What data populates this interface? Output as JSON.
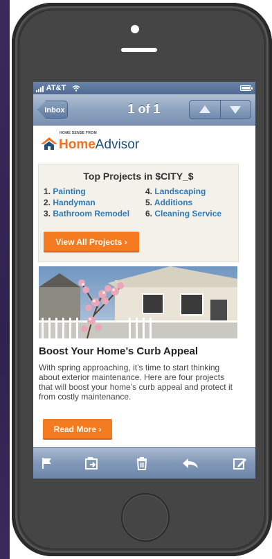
{
  "status_bar": {
    "carrier": "AT&T"
  },
  "nav": {
    "back_label": "Inbox",
    "title": "1 of 1",
    "up_icon": "arrow-up-icon",
    "down_icon": "arrow-down-icon"
  },
  "email": {
    "logo": {
      "tagline": "HOME SENSE FROM",
      "brand_home": "Home",
      "brand_advisor": "Advisor"
    },
    "projects": {
      "title": "Top Projects in $CITY_$",
      "left": [
        {
          "num": "1.",
          "label": "Painting"
        },
        {
          "num": "2.",
          "label": "Handyman"
        },
        {
          "num": "3.",
          "label": "Bathroom Remodel"
        }
      ],
      "right": [
        {
          "num": "4.",
          "label": "Landscaping"
        },
        {
          "num": "5.",
          "label": "Additions"
        },
        {
          "num": "6.",
          "label": "Cleaning Service"
        }
      ],
      "button": "View All Projects ›"
    },
    "article": {
      "title": "Boost Your Home’s Curb Appeal",
      "body": "With spring approaching, it’s time to start thinking about exterior maintenance. Here are four projects that will boost your home’s curb appeal and protect it from costly maintenance.",
      "button": "Read More ›"
    }
  },
  "toolbar": {
    "icons": [
      "flag-icon",
      "move-folder-icon",
      "trash-icon",
      "reply-icon",
      "compose-icon"
    ]
  },
  "colors": {
    "accent_orange": "#f47b20",
    "link_blue": "#2e79b6",
    "brand_blue": "#1f4f7a",
    "nav_blue": "#7a92b2"
  }
}
